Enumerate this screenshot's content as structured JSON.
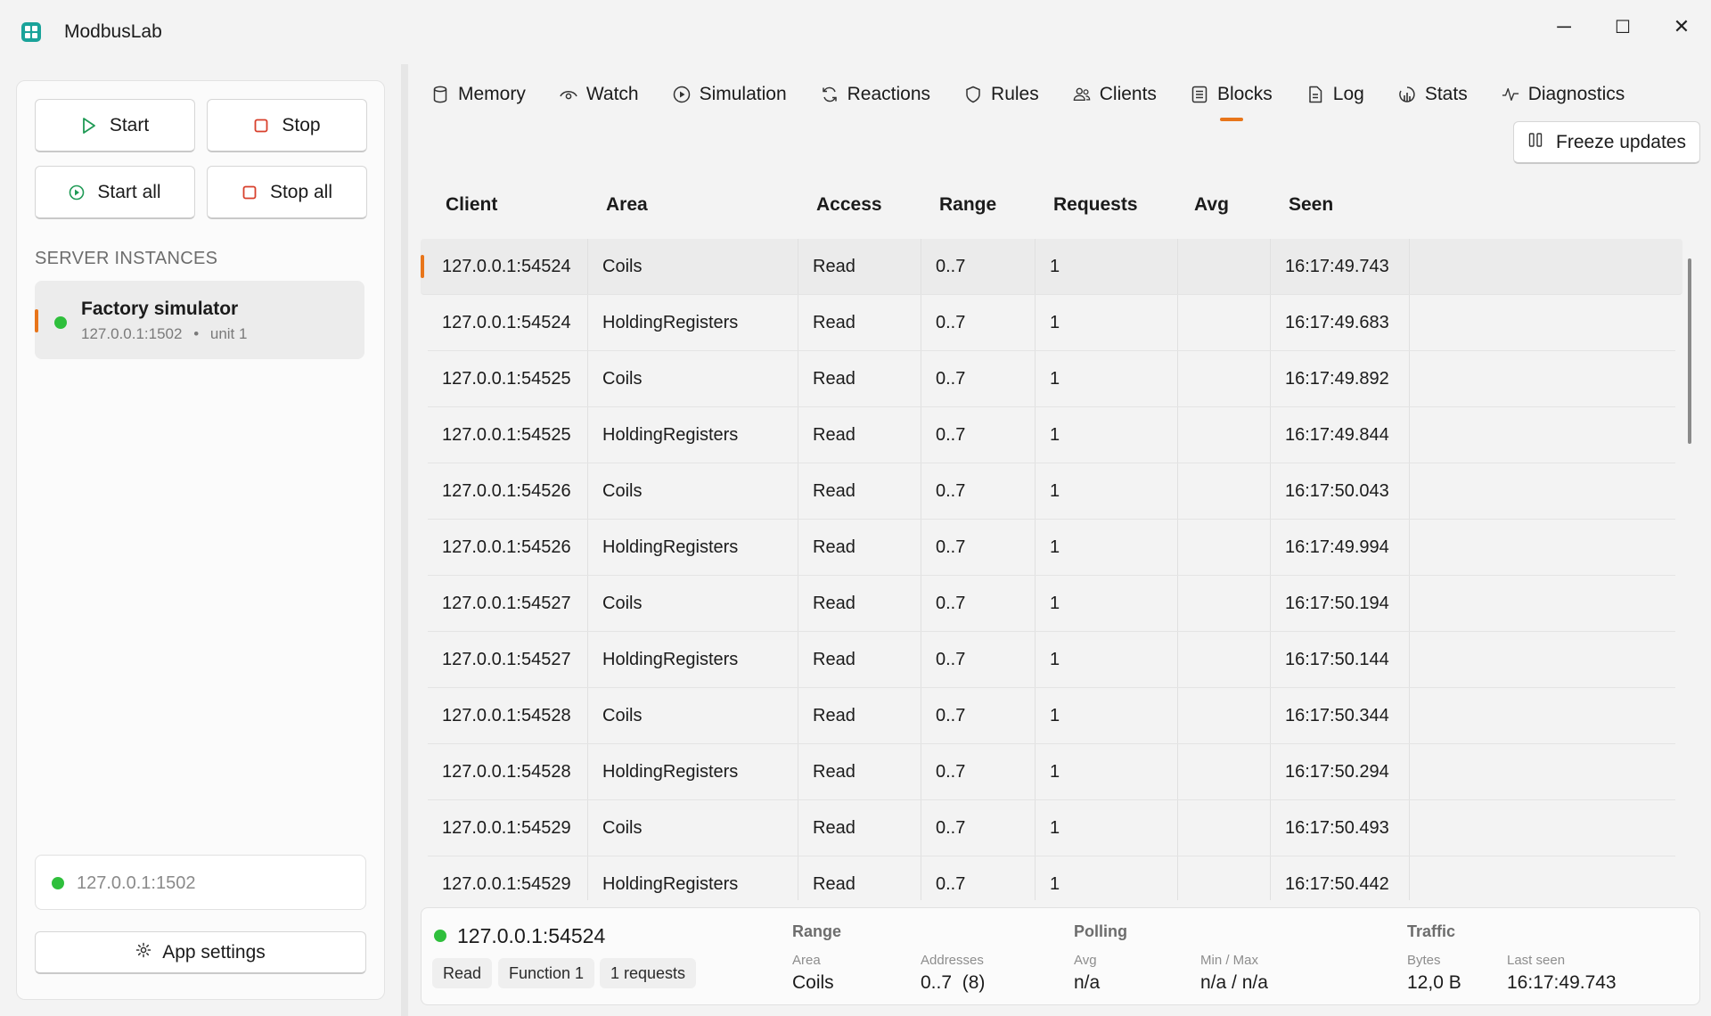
{
  "app": {
    "title": "ModbusLab"
  },
  "window_controls": {
    "minimize": "─",
    "maximize": "☐",
    "close": "✕"
  },
  "sidebar": {
    "start_label": "Start",
    "stop_label": "Stop",
    "start_all_label": "Start all",
    "stop_all_label": "Stop all",
    "section_title": "SERVER INSTANCES",
    "servers": [
      {
        "name": "Factory simulator",
        "endpoint": "127.0.0.1:1502",
        "unit": "unit 1",
        "separator": "•"
      }
    ],
    "status_endpoint": "127.0.0.1:1502",
    "settings_label": "App settings"
  },
  "tabs": [
    {
      "label": "Memory",
      "icon": "database-icon"
    },
    {
      "label": "Watch",
      "icon": "eye-icon"
    },
    {
      "label": "Simulation",
      "icon": "play-circle-icon"
    },
    {
      "label": "Reactions",
      "icon": "refresh-icon"
    },
    {
      "label": "Rules",
      "icon": "shield-icon"
    },
    {
      "label": "Clients",
      "icon": "users-icon"
    },
    {
      "label": "Blocks",
      "icon": "list-icon",
      "active": true
    },
    {
      "label": "Log",
      "icon": "document-icon"
    },
    {
      "label": "Stats",
      "icon": "stats-icon"
    },
    {
      "label": "Diagnostics",
      "icon": "pulse-icon"
    }
  ],
  "toolbar": {
    "freeze_label": "Freeze updates"
  },
  "table": {
    "columns": [
      "Client",
      "Area",
      "Access",
      "Range",
      "Requests",
      "Avg",
      "Seen"
    ],
    "rows": [
      {
        "client": "127.0.0.1:54524",
        "area": "Coils",
        "access": "Read",
        "range": "0..7",
        "requests": "1",
        "avg": "",
        "seen": "16:17:49.743"
      },
      {
        "client": "127.0.0.1:54524",
        "area": "HoldingRegisters",
        "access": "Read",
        "range": "0..7",
        "requests": "1",
        "avg": "",
        "seen": "16:17:49.683"
      },
      {
        "client": "127.0.0.1:54525",
        "area": "Coils",
        "access": "Read",
        "range": "0..7",
        "requests": "1",
        "avg": "",
        "seen": "16:17:49.892"
      },
      {
        "client": "127.0.0.1:54525",
        "area": "HoldingRegisters",
        "access": "Read",
        "range": "0..7",
        "requests": "1",
        "avg": "",
        "seen": "16:17:49.844"
      },
      {
        "client": "127.0.0.1:54526",
        "area": "Coils",
        "access": "Read",
        "range": "0..7",
        "requests": "1",
        "avg": "",
        "seen": "16:17:50.043"
      },
      {
        "client": "127.0.0.1:54526",
        "area": "HoldingRegisters",
        "access": "Read",
        "range": "0..7",
        "requests": "1",
        "avg": "",
        "seen": "16:17:49.994"
      },
      {
        "client": "127.0.0.1:54527",
        "area": "Coils",
        "access": "Read",
        "range": "0..7",
        "requests": "1",
        "avg": "",
        "seen": "16:17:50.194"
      },
      {
        "client": "127.0.0.1:54527",
        "area": "HoldingRegisters",
        "access": "Read",
        "range": "0..7",
        "requests": "1",
        "avg": "",
        "seen": "16:17:50.144"
      },
      {
        "client": "127.0.0.1:54528",
        "area": "Coils",
        "access": "Read",
        "range": "0..7",
        "requests": "1",
        "avg": "",
        "seen": "16:17:50.344"
      },
      {
        "client": "127.0.0.1:54528",
        "area": "HoldingRegisters",
        "access": "Read",
        "range": "0..7",
        "requests": "1",
        "avg": "",
        "seen": "16:17:50.294"
      },
      {
        "client": "127.0.0.1:54529",
        "area": "Coils",
        "access": "Read",
        "range": "0..7",
        "requests": "1",
        "avg": "",
        "seen": "16:17:50.493"
      },
      {
        "client": "127.0.0.1:54529",
        "area": "HoldingRegisters",
        "access": "Read",
        "range": "0..7",
        "requests": "1",
        "avg": "",
        "seen": "16:17:50.442"
      }
    ]
  },
  "details": {
    "client": "127.0.0.1:54524",
    "chips": [
      "Read",
      "Function 1",
      "1 requests"
    ],
    "range": {
      "heading": "Range",
      "area_label": "Area",
      "area_value": "Coils",
      "addresses_label": "Addresses",
      "addresses_value": "0..7  (8)"
    },
    "polling": {
      "heading": "Polling",
      "avg_label": "Avg",
      "avg_value": "n/a",
      "minmax_label": "Min / Max",
      "minmax_value": "n/a / n/a"
    },
    "traffic": {
      "heading": "Traffic",
      "bytes_label": "Bytes",
      "bytes_value": "12,0 B",
      "last_seen_label": "Last seen",
      "last_seen_value": "16:17:49.743"
    }
  },
  "colors": {
    "accent": "#e8751a",
    "status_ok": "#2fbf3c",
    "brand": "#1aa39a"
  }
}
